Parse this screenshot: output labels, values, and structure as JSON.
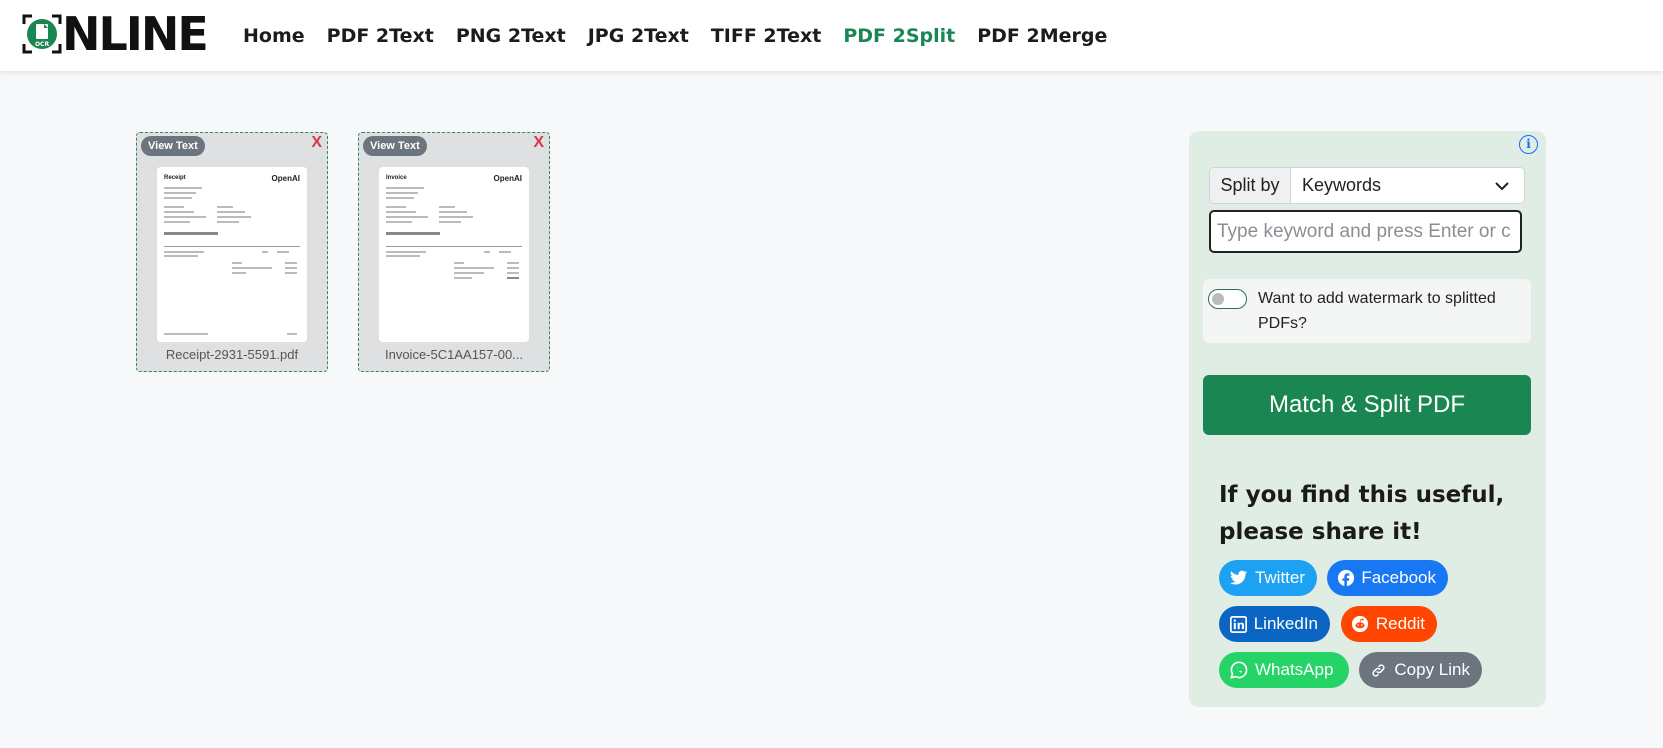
{
  "header": {
    "logo_text": "ONLINE",
    "nav": [
      {
        "label": "Home",
        "active": false
      },
      {
        "label": "PDF 2Text",
        "active": false
      },
      {
        "label": "PNG 2Text",
        "active": false
      },
      {
        "label": "JPG 2Text",
        "active": false
      },
      {
        "label": "TIFF 2Text",
        "active": false
      },
      {
        "label": "PDF 2Split",
        "active": true
      },
      {
        "label": "PDF 2Merge",
        "active": false
      }
    ]
  },
  "files": [
    {
      "view_label": "View Text",
      "remove_label": "X",
      "name": "Receipt-2931-5591.pdf",
      "doc_title": "Receipt",
      "doc_brand": "OpenAI"
    },
    {
      "view_label": "View Text",
      "remove_label": "X",
      "name": "Invoice-5C1AA157-00...",
      "doc_title": "Invoice",
      "doc_brand": "OpenAI"
    }
  ],
  "panel": {
    "info_icon": "i",
    "split_by_label": "Split by",
    "split_by_value": "Keywords",
    "keyword_input": {
      "value": "",
      "placeholder": "Type keyword and press Enter or c"
    },
    "watermark": {
      "checked": false,
      "label": "Want to add watermark to splitted PDFs?"
    },
    "action_button": "Match & Split PDF",
    "share_title": "If you find this useful, please share it!",
    "share_buttons": [
      {
        "label": "Twitter",
        "icon": "twitter-icon"
      },
      {
        "label": "Facebook",
        "icon": "facebook-icon"
      },
      {
        "label": "LinkedIn",
        "icon": "linkedin-icon"
      },
      {
        "label": "Reddit",
        "icon": "reddit-icon"
      },
      {
        "label": "WhatsApp",
        "icon": "whatsapp-icon"
      },
      {
        "label": "Copy Link",
        "icon": "link-icon"
      }
    ]
  },
  "colors": {
    "accent": "#198754",
    "action_button": "#1a8752",
    "panel_bg": "#e0ede5",
    "twitter": "#1da1f2",
    "facebook": "#1877f2",
    "linkedin": "#0a66c2",
    "reddit": "#ff4500",
    "whatsapp": "#25d366",
    "copy_link": "#6c757d"
  }
}
